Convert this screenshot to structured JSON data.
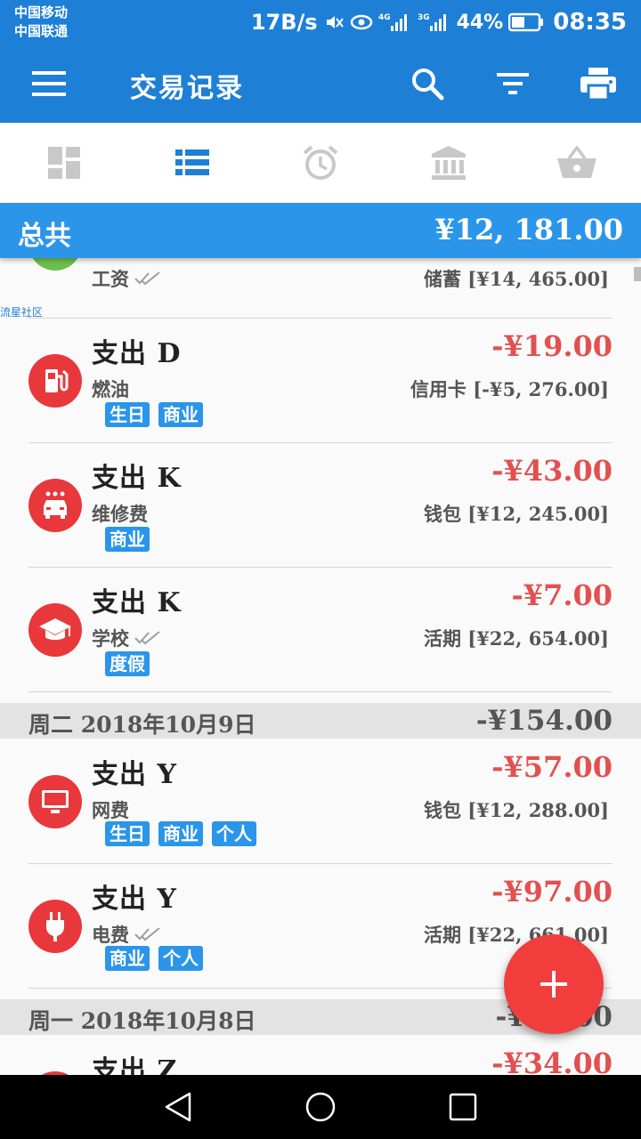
{
  "status": {
    "carrier1": "中国移动",
    "carrier2": "中国联通",
    "speed": "17B/s",
    "battery": "44%",
    "time": "08:35"
  },
  "appbar": {
    "title": "交易记录",
    "icons": [
      "menu-icon",
      "search-icon",
      "filter-icon",
      "print-icon"
    ]
  },
  "tabs": [
    {
      "icon": "dashboard-icon"
    },
    {
      "icon": "list-icon",
      "active": true
    },
    {
      "icon": "alarm-icon"
    },
    {
      "icon": "bank-icon"
    },
    {
      "icon": "basket-icon"
    }
  ],
  "total": {
    "label": "总共",
    "value": "¥12, 181.00"
  },
  "watermark": "流星社区",
  "transactions": [
    {
      "category": "工资",
      "account": "储蓄",
      "balance": "[¥14, 465.00]",
      "icon": "wallet-icon",
      "cleared": true
    },
    {
      "title": "支出 D",
      "category": "燃油",
      "amount": "-¥19.00",
      "account": "信用卡",
      "balance": "[-¥5, 276.00]",
      "tags": [
        "生日",
        "商业"
      ],
      "icon": "fuel-icon"
    },
    {
      "title": "支出 K",
      "category": "维修费",
      "amount": "-¥43.00",
      "account": "钱包",
      "balance": "[¥12, 245.00]",
      "tags": [
        "商业"
      ],
      "icon": "car-wash-icon"
    },
    {
      "title": "支出 K",
      "category": "学校",
      "amount": "-¥7.00",
      "account": "活期",
      "balance": "[¥22, 654.00]",
      "tags": [
        "度假"
      ],
      "icon": "school-icon",
      "cleared": true
    }
  ],
  "day1": {
    "label": "周二  2018年10月9日",
    "total": "-¥154.00"
  },
  "transactions2": [
    {
      "title": "支出 Y",
      "category": "网费",
      "amount": "-¥57.00",
      "account": "钱包",
      "balance": "[¥12, 288.00]",
      "tags": [
        "生日",
        "商业",
        "个人"
      ],
      "icon": "monitor-icon"
    },
    {
      "title": "支出 Y",
      "category": "电费",
      "amount": "-¥97.00",
      "account": "活期",
      "balance": "[¥22, 661.00]",
      "tags": [
        "商业",
        "个人"
      ],
      "icon": "plug-icon",
      "cleared": true
    }
  ],
  "day2": {
    "label": "周一  2018年10月8日",
    "total": "-¥34.00"
  },
  "transactions3": [
    {
      "title": "支出 Z",
      "amount": "-¥34.00"
    }
  ],
  "colors": {
    "primary": "#1e7fd6",
    "accent": "#2b95ea",
    "expense": "#e25050",
    "fab": "#f23d3d"
  }
}
